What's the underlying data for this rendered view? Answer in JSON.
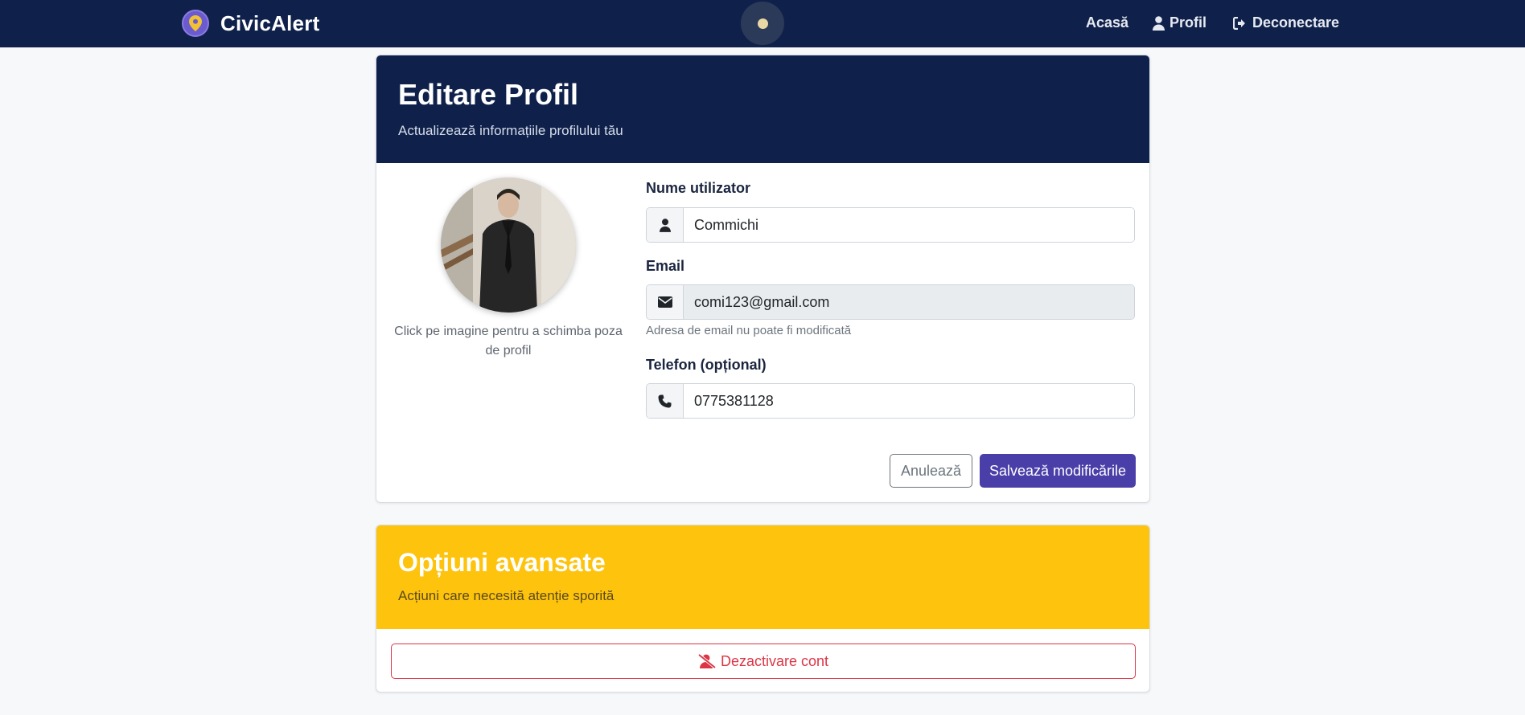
{
  "navbar": {
    "brand": "CivicAlert",
    "links": [
      {
        "label": "Acasă",
        "icon": "home"
      },
      {
        "label": "Profil",
        "icon": "user-icon"
      },
      {
        "label": "Deconectare",
        "icon": "sign-out-icon"
      }
    ]
  },
  "profile_card": {
    "title": "Editare Profil",
    "subtitle": "Actualizează informațiile profilului tău",
    "avatar_caption": "Click pe imagine pentru a schimba poza de profil",
    "fields": {
      "username": {
        "label": "Nume utilizator",
        "value": "Commichi"
      },
      "email": {
        "label": "Email",
        "value": "comi123@gmail.com",
        "help": "Adresa de email nu poate fi modificată"
      },
      "phone": {
        "label": "Telefon (opțional)",
        "value": "0775381128"
      }
    },
    "buttons": {
      "cancel": "Anulează",
      "save": "Salvează modificările"
    }
  },
  "advanced_card": {
    "title": "Opțiuni avansate",
    "subtitle": "Acțiuni care necesită atenție sporită",
    "deactivate_label": "Dezactivare cont"
  },
  "colors": {
    "navbar_bg": "#0f214b",
    "primary": "#4a3ea8",
    "warning": "#fec30d",
    "danger": "#dc3545"
  }
}
